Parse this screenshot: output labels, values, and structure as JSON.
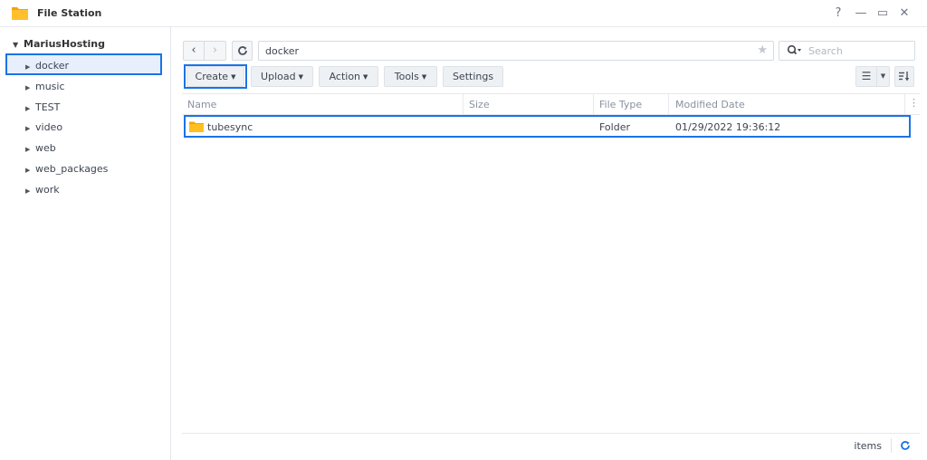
{
  "window": {
    "title": "File Station",
    "controls": {
      "help": "?",
      "minimize": "—",
      "maximize": "▭",
      "close": "✕"
    }
  },
  "sidebar": {
    "root": "MariusHosting",
    "items": [
      {
        "label": "docker",
        "selected": true
      },
      {
        "label": "music"
      },
      {
        "label": "TEST"
      },
      {
        "label": "video"
      },
      {
        "label": "web"
      },
      {
        "label": "web_packages"
      },
      {
        "label": "work"
      }
    ]
  },
  "navigation": {
    "back": "‹",
    "forward": "›",
    "refresh": "C",
    "path": "docker",
    "search_placeholder": "Search"
  },
  "toolbar": {
    "create": "Create",
    "upload": "Upload",
    "action": "Action",
    "tools": "Tools",
    "settings": "Settings"
  },
  "table": {
    "columns": [
      "Name",
      "Size",
      "File Type",
      "Modified Date"
    ],
    "rows": [
      {
        "name": "tubesync",
        "size": "",
        "type": "Folder",
        "modified": "01/29/2022 19:36:12",
        "icon": "folder-icon"
      }
    ]
  },
  "footer": {
    "items_label": "items"
  },
  "colors": {
    "accent": "#1a73e8",
    "folder": "#f7a800"
  }
}
